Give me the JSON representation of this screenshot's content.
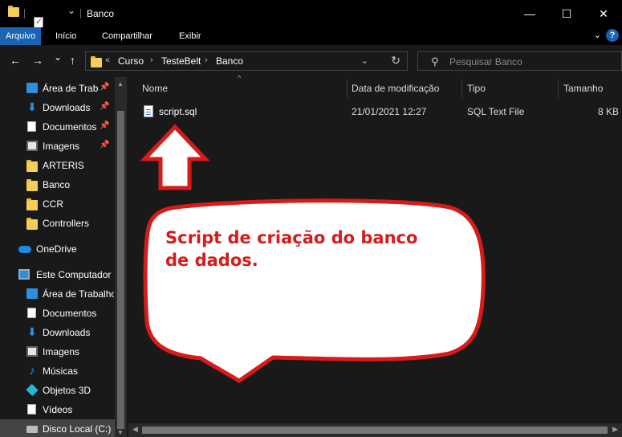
{
  "window": {
    "title": "Banco",
    "controls": {
      "minimize": "—",
      "maximize": "☐",
      "close": "✕"
    }
  },
  "ribbon": {
    "tabs": [
      {
        "label": "Arquivo",
        "active": true
      },
      {
        "label": "Início"
      },
      {
        "label": "Compartilhar"
      },
      {
        "label": "Exibir"
      }
    ],
    "help": "?"
  },
  "address": {
    "back": "←",
    "forward": "→",
    "recent": "⌄",
    "up": "↑",
    "overflow": "«",
    "crumbs": [
      "Curso",
      "TesteBelt",
      "Banco"
    ],
    "crumb_sep": "›",
    "dropdown": "⌄",
    "refresh": "↻"
  },
  "search": {
    "placeholder": "Pesquisar Banco",
    "icon": "search-icon"
  },
  "sidebar": {
    "items": [
      {
        "label": "Área de Traba",
        "icon": "desktop-icon",
        "pinned": true
      },
      {
        "label": "Downloads",
        "icon": "download-icon",
        "pinned": true
      },
      {
        "label": "Documentos",
        "icon": "document-icon",
        "pinned": true
      },
      {
        "label": "Imagens",
        "icon": "image-icon",
        "pinned": true
      },
      {
        "label": "ARTERIS",
        "icon": "folder-icon"
      },
      {
        "label": "Banco",
        "icon": "folder-icon"
      },
      {
        "label": "CCR",
        "icon": "folder-icon"
      },
      {
        "label": "Controllers",
        "icon": "folder-icon"
      },
      {
        "label": "OneDrive",
        "icon": "cloud-icon"
      },
      {
        "label": "Este Computador",
        "icon": "computer-icon"
      },
      {
        "label": "Área de Trabalho",
        "icon": "desktop-icon"
      },
      {
        "label": "Documentos",
        "icon": "document-icon"
      },
      {
        "label": "Downloads",
        "icon": "download-icon"
      },
      {
        "label": "Imagens",
        "icon": "image-icon"
      },
      {
        "label": "Músicas",
        "icon": "music-icon"
      },
      {
        "label": "Objetos 3D",
        "icon": "3d-objects-icon"
      },
      {
        "label": "Vídeos",
        "icon": "video-icon"
      },
      {
        "label": "Disco Local (C:)",
        "icon": "disk-icon",
        "selected": true
      }
    ],
    "pin_glyph": "📌"
  },
  "columns": {
    "name": "Nome",
    "modified": "Data de modificação",
    "type": "Tipo",
    "size": "Tamanho"
  },
  "files": [
    {
      "name": "script.sql",
      "modified": "21/01/2021 12:27",
      "type": "SQL Text File",
      "size": "8 KB"
    }
  ],
  "annotation": {
    "callout_text": "Script de criação do banco de dados.",
    "color": "#d71a1a"
  }
}
